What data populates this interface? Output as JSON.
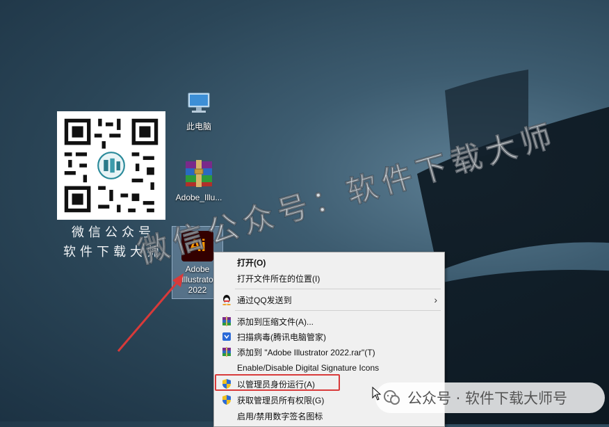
{
  "qr_caption": {
    "line1": "微信公众号",
    "line2": "软件下载大师"
  },
  "desktop_icons": {
    "this_pc": "此电脑",
    "rar": "Adobe_Illu...",
    "ai_line1": "Adobe",
    "ai_line2": "Illustrato",
    "ai_line3": "2022",
    "ai_tile": "Ai"
  },
  "context_menu": {
    "items": [
      {
        "label": "打开(O)"
      },
      {
        "label": "打开文件所在的位置(I)"
      },
      {
        "label": "通过QQ发送到"
      },
      {
        "label": "添加到压缩文件(A)..."
      },
      {
        "label": "扫描病毒(腾讯电脑管家)"
      },
      {
        "label": "添加到 \"Adobe Illustrator 2022.rar\"(T)"
      },
      {
        "label": "Enable/Disable Digital Signature Icons"
      },
      {
        "label": "以管理员身份运行(A)"
      },
      {
        "label": "获取管理员所有权限(G)"
      },
      {
        "label": "启用/禁用数字签名图标"
      }
    ],
    "submenu_arrow": "›"
  },
  "watermark": "微信公众号：软件下载大师",
  "wechat_badge": "公众号 · 软件下载大师号",
  "colors": {
    "highlight": "#d83a3a",
    "menu_bg": "#f0f0f0",
    "ai_orange": "#ff9a00"
  }
}
